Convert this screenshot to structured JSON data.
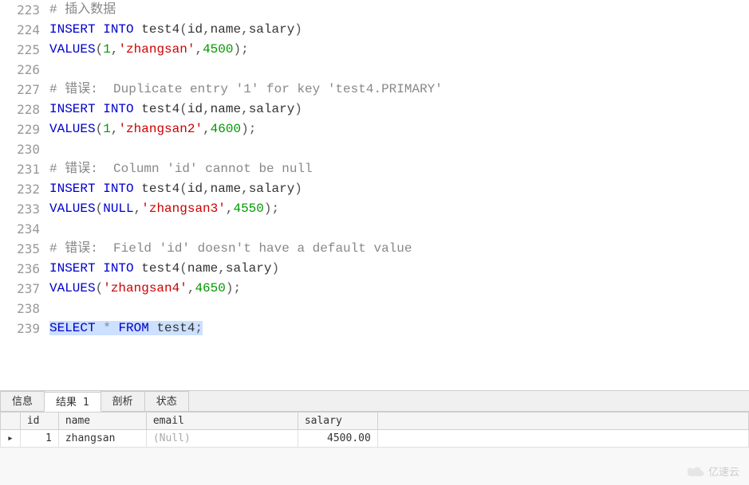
{
  "editor": {
    "lines": [
      {
        "num": 223,
        "tokens": [
          {
            "t": "# 插入数据",
            "c": "tok-comment"
          }
        ]
      },
      {
        "num": 224,
        "tokens": [
          {
            "t": "INSERT",
            "c": "tok-keyword"
          },
          {
            "t": " ",
            "c": ""
          },
          {
            "t": "INTO",
            "c": "tok-keyword"
          },
          {
            "t": " ",
            "c": ""
          },
          {
            "t": "test4",
            "c": "tok-ident"
          },
          {
            "t": "(",
            "c": "tok-punct"
          },
          {
            "t": "id",
            "c": "tok-ident"
          },
          {
            "t": ",",
            "c": "tok-punct"
          },
          {
            "t": "name",
            "c": "tok-ident"
          },
          {
            "t": ",",
            "c": "tok-punct"
          },
          {
            "t": "salary",
            "c": "tok-ident"
          },
          {
            "t": ")",
            "c": "tok-punct"
          }
        ]
      },
      {
        "num": 225,
        "tokens": [
          {
            "t": "VALUES",
            "c": "tok-keyword"
          },
          {
            "t": "(",
            "c": "tok-punct"
          },
          {
            "t": "1",
            "c": "tok-number"
          },
          {
            "t": ",",
            "c": "tok-punct"
          },
          {
            "t": "'zhangsan'",
            "c": "tok-string"
          },
          {
            "t": ",",
            "c": "tok-punct"
          },
          {
            "t": "4500",
            "c": "tok-number"
          },
          {
            "t": ")",
            "c": "tok-punct"
          },
          {
            "t": ";",
            "c": "tok-punct"
          }
        ]
      },
      {
        "num": 226,
        "tokens": []
      },
      {
        "num": 227,
        "tokens": [
          {
            "t": "# 错误:  Duplicate entry '1' for key 'test4.PRIMARY'",
            "c": "tok-comment"
          }
        ]
      },
      {
        "num": 228,
        "tokens": [
          {
            "t": "INSERT",
            "c": "tok-keyword"
          },
          {
            "t": " ",
            "c": ""
          },
          {
            "t": "INTO",
            "c": "tok-keyword"
          },
          {
            "t": " ",
            "c": ""
          },
          {
            "t": "test4",
            "c": "tok-ident"
          },
          {
            "t": "(",
            "c": "tok-punct"
          },
          {
            "t": "id",
            "c": "tok-ident"
          },
          {
            "t": ",",
            "c": "tok-punct"
          },
          {
            "t": "name",
            "c": "tok-ident"
          },
          {
            "t": ",",
            "c": "tok-punct"
          },
          {
            "t": "salary",
            "c": "tok-ident"
          },
          {
            "t": ")",
            "c": "tok-punct"
          }
        ]
      },
      {
        "num": 229,
        "tokens": [
          {
            "t": "VALUES",
            "c": "tok-keyword"
          },
          {
            "t": "(",
            "c": "tok-punct"
          },
          {
            "t": "1",
            "c": "tok-number"
          },
          {
            "t": ",",
            "c": "tok-punct"
          },
          {
            "t": "'zhangsan2'",
            "c": "tok-string"
          },
          {
            "t": ",",
            "c": "tok-punct"
          },
          {
            "t": "4600",
            "c": "tok-number"
          },
          {
            "t": ")",
            "c": "tok-punct"
          },
          {
            "t": ";",
            "c": "tok-punct"
          }
        ]
      },
      {
        "num": 230,
        "tokens": []
      },
      {
        "num": 231,
        "tokens": [
          {
            "t": "# 错误:  Column 'id' cannot be null",
            "c": "tok-comment"
          }
        ]
      },
      {
        "num": 232,
        "tokens": [
          {
            "t": "INSERT",
            "c": "tok-keyword"
          },
          {
            "t": " ",
            "c": ""
          },
          {
            "t": "INTO",
            "c": "tok-keyword"
          },
          {
            "t": " ",
            "c": ""
          },
          {
            "t": "test4",
            "c": "tok-ident"
          },
          {
            "t": "(",
            "c": "tok-punct"
          },
          {
            "t": "id",
            "c": "tok-ident"
          },
          {
            "t": ",",
            "c": "tok-punct"
          },
          {
            "t": "name",
            "c": "tok-ident"
          },
          {
            "t": ",",
            "c": "tok-punct"
          },
          {
            "t": "salary",
            "c": "tok-ident"
          },
          {
            "t": ")",
            "c": "tok-punct"
          }
        ]
      },
      {
        "num": 233,
        "tokens": [
          {
            "t": "VALUES",
            "c": "tok-keyword"
          },
          {
            "t": "(",
            "c": "tok-punct"
          },
          {
            "t": "NULL",
            "c": "tok-keyword"
          },
          {
            "t": ",",
            "c": "tok-punct"
          },
          {
            "t": "'zhangsan3'",
            "c": "tok-string"
          },
          {
            "t": ",",
            "c": "tok-punct"
          },
          {
            "t": "4550",
            "c": "tok-number"
          },
          {
            "t": ")",
            "c": "tok-punct"
          },
          {
            "t": ";",
            "c": "tok-punct"
          }
        ]
      },
      {
        "num": 234,
        "tokens": []
      },
      {
        "num": 235,
        "tokens": [
          {
            "t": "# 错误:  Field 'id' doesn't have a default value",
            "c": "tok-comment"
          }
        ]
      },
      {
        "num": 236,
        "tokens": [
          {
            "t": "INSERT",
            "c": "tok-keyword"
          },
          {
            "t": " ",
            "c": ""
          },
          {
            "t": "INTO",
            "c": "tok-keyword"
          },
          {
            "t": " ",
            "c": ""
          },
          {
            "t": "test4",
            "c": "tok-ident"
          },
          {
            "t": "(",
            "c": "tok-punct"
          },
          {
            "t": "name",
            "c": "tok-ident"
          },
          {
            "t": ",",
            "c": "tok-punct"
          },
          {
            "t": "salary",
            "c": "tok-ident"
          },
          {
            "t": ")",
            "c": "tok-punct"
          }
        ]
      },
      {
        "num": 237,
        "tokens": [
          {
            "t": "VALUES",
            "c": "tok-keyword"
          },
          {
            "t": "(",
            "c": "tok-punct"
          },
          {
            "t": "'zhangsan4'",
            "c": "tok-string"
          },
          {
            "t": ",",
            "c": "tok-punct"
          },
          {
            "t": "4650",
            "c": "tok-number"
          },
          {
            "t": ")",
            "c": "tok-punct"
          },
          {
            "t": ";",
            "c": "tok-punct"
          }
        ]
      },
      {
        "num": 238,
        "tokens": []
      },
      {
        "num": 239,
        "highlight": true,
        "tokens": [
          {
            "t": "SELECT",
            "c": "tok-keyword",
            "hl": true
          },
          {
            "t": " ",
            "c": "",
            "hl": true
          },
          {
            "t": "*",
            "c": "tok-star",
            "hl": true
          },
          {
            "t": " ",
            "c": "",
            "hl": true
          },
          {
            "t": "FROM",
            "c": "tok-keyword",
            "hl": true
          },
          {
            "t": " ",
            "c": "",
            "hl": true
          },
          {
            "t": "test4",
            "c": "tok-ident",
            "hl": true
          },
          {
            "t": ";",
            "c": "tok-punct",
            "hl": true
          }
        ]
      }
    ]
  },
  "tabs": {
    "items": [
      {
        "label": "信息",
        "active": false
      },
      {
        "label": "结果 1",
        "active": true
      },
      {
        "label": "剖析",
        "active": false
      },
      {
        "label": "状态",
        "active": false
      }
    ]
  },
  "result": {
    "columns": [
      "id",
      "name",
      "email",
      "salary"
    ],
    "rows": [
      {
        "ptr": "▸",
        "id": "1",
        "name": "zhangsan",
        "email": "(Null)",
        "email_null": true,
        "salary": "4500.00"
      }
    ]
  },
  "watermark": {
    "text": "亿速云"
  }
}
